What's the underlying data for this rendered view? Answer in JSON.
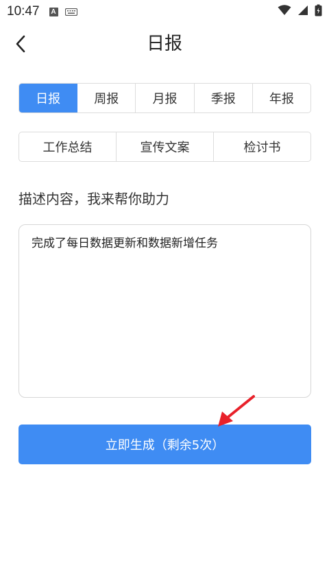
{
  "status_bar": {
    "time": "10:47",
    "a_badge": "A"
  },
  "header": {
    "title": "日报",
    "back_icon": "chevron-left-icon"
  },
  "tabs": [
    {
      "label": "日报",
      "active": true
    },
    {
      "label": "周报",
      "active": false
    },
    {
      "label": "月报",
      "active": false
    },
    {
      "label": "季报",
      "active": false
    },
    {
      "label": "年报",
      "active": false
    }
  ],
  "types": [
    {
      "label": "工作总结"
    },
    {
      "label": "宣传文案"
    },
    {
      "label": "检讨书"
    }
  ],
  "prompt": {
    "label": "描述内容，我来帮你助力"
  },
  "description": {
    "value": "完成了每日数据更新和数据新增任务"
  },
  "generate": {
    "label": "立即生成（剩余5次）"
  },
  "colors": {
    "accent": "#3f8cf3",
    "annotation": "#e8212a"
  }
}
